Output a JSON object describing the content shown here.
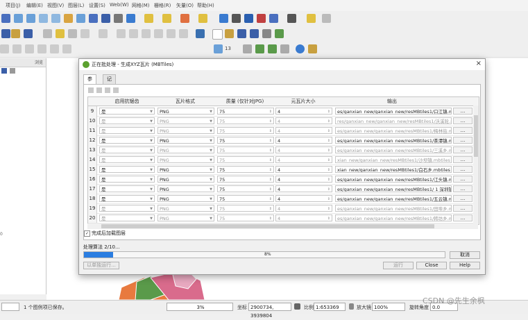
{
  "toolbar_row3_num": "13",
  "sidepanel": {
    "header_label": "浏览",
    "tick_label": "0"
  },
  "dialog": {
    "title": "正在批处理 - 生成XYZ瓦片 (MBTiles)",
    "close_glyph": "×",
    "tabs": [
      {
        "label": "参数"
      },
      {
        "label": "记录"
      }
    ],
    "columns": [
      "",
      "启用抗锯齿",
      "瓦片格式",
      "质量 (仅针对JPG)",
      "元瓦片大小",
      "输出",
      ""
    ],
    "rows": [
      {
        "num": "9",
        "antialias": "是",
        "format": "PNG",
        "quality": "75",
        "meta": "4",
        "output": "es/ganxian_new/ganxian_new/resMBtiles1/口江镇.m",
        "btn": "...",
        "dim": false
      },
      {
        "num": "10",
        "antialias": "是",
        "format": "PNG",
        "quality": "75",
        "meta": "4",
        "output": "res/ganxian_new/ganxian_new/resMBtiles1/沃溪轮.m",
        "btn": "...",
        "dim": true
      },
      {
        "num": "11",
        "antialias": "是",
        "format": "PNG",
        "quality": "75",
        "meta": "4",
        "output": "es/ganxian_new/ganxian_new/resMBtiles1/梅林街.m",
        "btn": "...",
        "dim": true
      },
      {
        "num": "12",
        "antialias": "是",
        "format": "PNG",
        "quality": "75",
        "meta": "4",
        "output": "es/ganxian_new/ganxian_new/resMBtiles1/茶潭镇.m",
        "btn": "...",
        "dim": false
      },
      {
        "num": "13",
        "antialias": "是",
        "format": "PNG",
        "quality": "75",
        "meta": "4",
        "output": "es/ganxian_new/ganxian_new/resMBtiles1/三溪乡.m",
        "btn": "...",
        "dim": true
      },
      {
        "num": "14",
        "antialias": "是",
        "format": "PNG",
        "quality": "75",
        "meta": "4",
        "output": "xian_new/ganxian_new/resMBtiles1/沙坝镇.mbtiles",
        "btn": "...",
        "dim": true
      },
      {
        "num": "15",
        "antialias": "是",
        "format": "PNG",
        "quality": "75",
        "meta": "4",
        "output": "xian_new/ganxian_new/resMBtiles1/白石乡.mbtiles",
        "btn": "...",
        "dim": false
      },
      {
        "num": "16",
        "antialias": "是",
        "format": "PNG",
        "quality": "75",
        "meta": "4",
        "output": "es/ganxian_new/ganxian_new/resMBtiles1/江头镇.m",
        "btn": "...",
        "dim": false
      },
      {
        "num": "17",
        "antialias": "是",
        "format": "PNG",
        "quality": "75",
        "meta": "4",
        "output": "es/ganxian_new/ganxian_new/resMBtiles1/ 1 深圳镇",
        "btn": "...",
        "dim": false
      },
      {
        "num": "18",
        "antialias": "是",
        "format": "PNG",
        "quality": "75",
        "meta": "4",
        "output": "es/ganxian_new/ganxian_new/resMBtiles1/五云镇.m",
        "btn": "...",
        "dim": false
      },
      {
        "num": "19",
        "antialias": "是",
        "format": "PNG",
        "quality": "75",
        "meta": "4",
        "output": "es/ganxian_new/ganxian_new/resMBtiles1/田埠乡.m",
        "btn": "...",
        "dim": true
      },
      {
        "num": "20",
        "antialias": "是",
        "format": "PNG",
        "quality": "75",
        "meta": "4",
        "output": "es/ganxian_new/ganxian_new/resMBtiles1/韩坊乡.m",
        "btn": "...",
        "dim": true
      }
    ],
    "load_checkbox": "完成后加载图层",
    "progress_label": "处理算法 2/10...",
    "progress_value": 0.08,
    "progress_text": "8%",
    "cancel": "取消",
    "background_btn": "以单独运行...",
    "run": "运行",
    "close": "Close",
    "help": "Help"
  },
  "toast": "编辑",
  "watermark": "CSDN @先生余枫",
  "statusbar": {
    "search_placeholder": "",
    "message": "1 个图例项已保存。",
    "progress_text": "3%",
    "coord_label": "坐标",
    "coord_value": "2900734, 3939804",
    "scale_label": "比例",
    "scale_value": "1:653369",
    "mag_label": "放大镜",
    "mag_value": "100%",
    "rotation_label": "旋转角度",
    "rotation_value": "0.0"
  },
  "colors": {
    "accent": "#2a7de1",
    "dialog_bg": "#f0f0f0",
    "map_pink": "#d96b8c",
    "map_orange": "#e87a3f",
    "map_green": "#5a9a4a"
  }
}
